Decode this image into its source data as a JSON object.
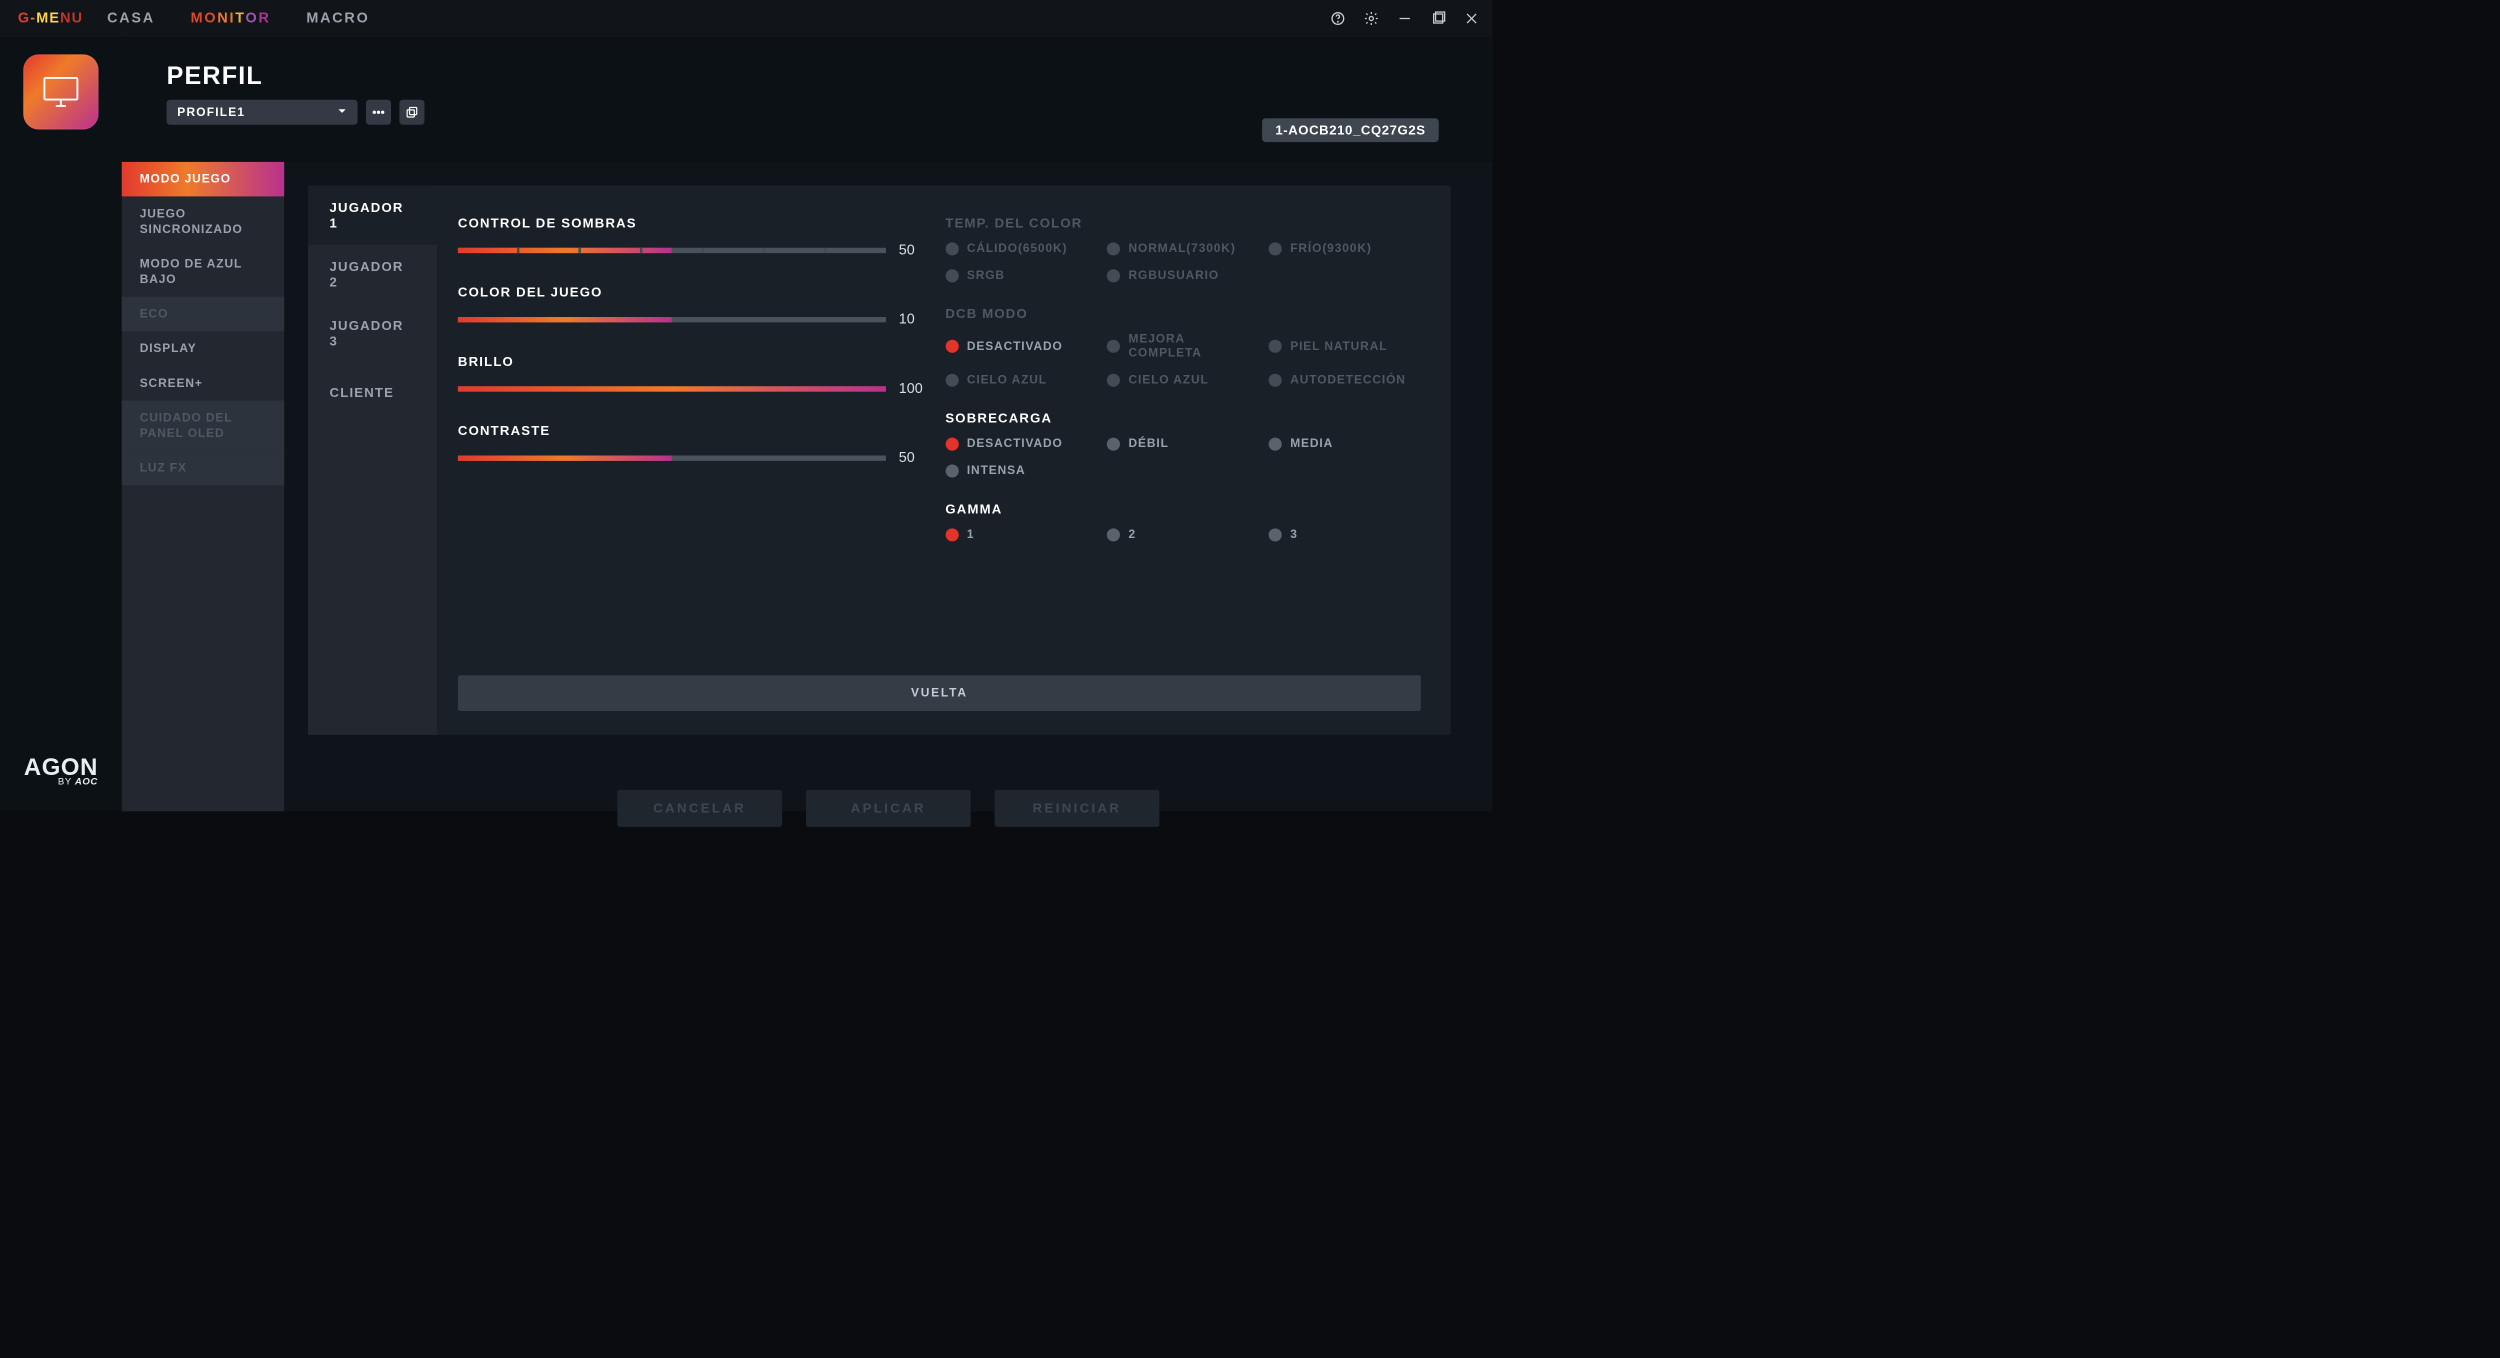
{
  "titlebar": {
    "logo_text": "G-MENU",
    "nav": {
      "casa": "CASA",
      "monitor": "MONITOR",
      "macro": "MACRO"
    }
  },
  "header": {
    "title": "PERFIL",
    "profile_selected": "PROFILE1",
    "monitor_badge": "1-AOCB210_CQ27G2S"
  },
  "sidebar": {
    "items": [
      {
        "label": "MODO JUEGO",
        "active": true
      },
      {
        "label": "JUEGO SINCRONIZADO"
      },
      {
        "label": "MODO DE AZUL BAJO"
      },
      {
        "label": "ECO",
        "disabled": true
      },
      {
        "label": "DISPLAY"
      },
      {
        "label": "SCREEN+"
      },
      {
        "label": "CUIDADO DEL PANEL OLED",
        "disabled": true
      },
      {
        "label": "LUZ FX",
        "disabled": true
      }
    ]
  },
  "subnav": [
    {
      "label": "JUGADOR 1",
      "active": true
    },
    {
      "label": "JUGADOR 2"
    },
    {
      "label": "JUGADOR 3"
    },
    {
      "label": "CLIENTE"
    }
  ],
  "sliders": {
    "shadow": {
      "label": "CONTROL DE SOMBRAS",
      "value": 50
    },
    "gamecolor": {
      "label": "COLOR DEL JUEGO",
      "value": 10,
      "max": 20
    },
    "bright": {
      "label": "BRILLO",
      "value": 100
    },
    "contrast": {
      "label": "CONTRASTE",
      "value": 50
    }
  },
  "groups": {
    "colortemp": {
      "label": "TEMP. DEL COLOR",
      "disabled": true,
      "options": [
        {
          "label": "CÁLIDO(6500K)"
        },
        {
          "label": "NORMAL(7300K)"
        },
        {
          "label": "FRÍO(9300K)"
        },
        {
          "label": "SRGB"
        },
        {
          "label": "RGBUSUARIO"
        }
      ]
    },
    "dcb": {
      "label": "DCB MODO",
      "disabled": true,
      "options": [
        {
          "label": "DESACTIVADO",
          "selected": true
        },
        {
          "label": "MEJORA COMPLETA"
        },
        {
          "label": "PIEL NATURAL"
        },
        {
          "label": "CIELO AZUL"
        },
        {
          "label": "CIELO AZUL"
        },
        {
          "label": "AUTODETECCIÓN"
        }
      ]
    },
    "overdrive": {
      "label": "SOBRECARGA",
      "options": [
        {
          "label": "DESACTIVADO",
          "selected": true
        },
        {
          "label": "DÉBIL"
        },
        {
          "label": "MEDIA"
        },
        {
          "label": "INTENSA"
        }
      ]
    },
    "gamma": {
      "label": "GAMMA",
      "options": [
        {
          "label": "1",
          "selected": true
        },
        {
          "label": "2"
        },
        {
          "label": "3"
        }
      ]
    }
  },
  "buttons": {
    "back": "VUELTA",
    "cancel": "CANCELAR",
    "apply": "APLICAR",
    "reset": "REINICIAR"
  },
  "brand": {
    "line1": "AGON",
    "line2_prefix": "BY ",
    "line2_bold": "AOC"
  }
}
